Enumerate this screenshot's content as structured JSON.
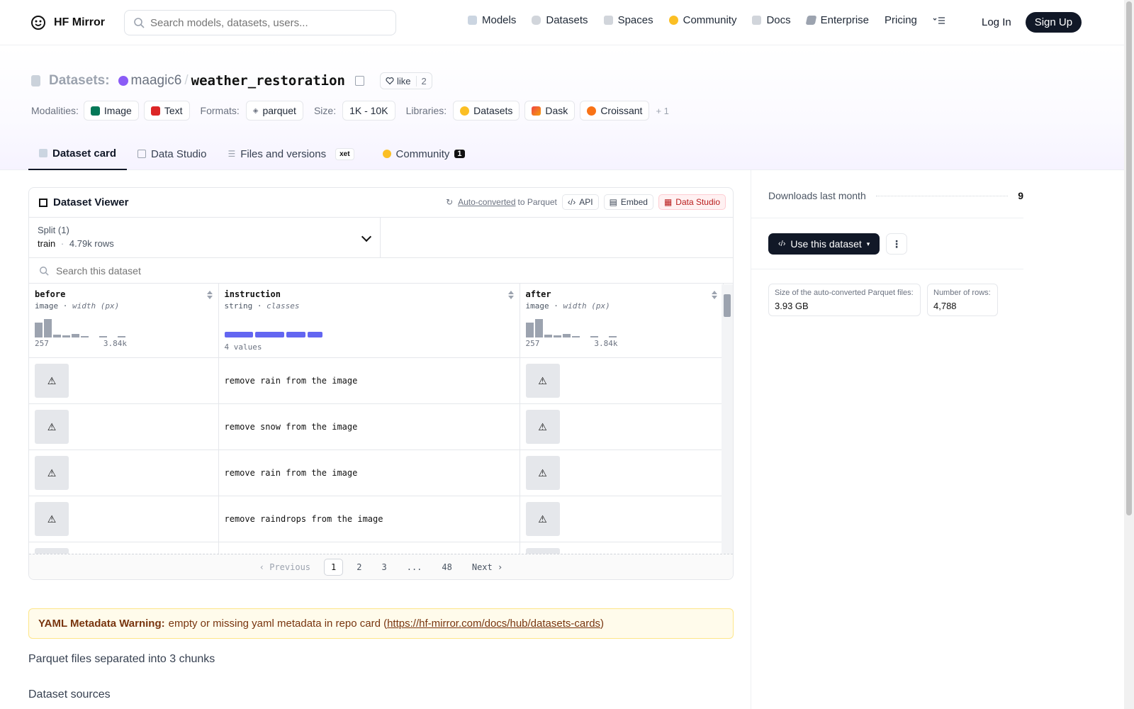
{
  "nav": {
    "brand": "HF Mirror",
    "search_placeholder": "Search models, datasets, users...",
    "links": [
      "Models",
      "Datasets",
      "Spaces",
      "Community",
      "Docs",
      "Enterprise",
      "Pricing"
    ],
    "login": "Log In",
    "signup": "Sign Up"
  },
  "header": {
    "section": "Datasets:",
    "owner": "maagic6",
    "slash": "/",
    "repo": "weather_restoration",
    "like_label": "like",
    "like_count": "2",
    "modalities_label": "Modalities:",
    "modalities": [
      "Image",
      "Text"
    ],
    "formats_label": "Formats:",
    "format": "parquet",
    "size_label": "Size:",
    "size": "1K - 10K",
    "libraries_label": "Libraries:",
    "libraries": [
      "Datasets",
      "Dask",
      "Croissant"
    ],
    "more_libraries": "+ 1"
  },
  "tabs": {
    "dataset_card": "Dataset card",
    "data_studio": "Data Studio",
    "files": "Files and versions",
    "xet": "xet",
    "community": "Community",
    "community_count": "1"
  },
  "viewer": {
    "title": "Dataset Viewer",
    "auto_converted": "Auto-converted",
    "to_parquet": "to Parquet",
    "api": "API",
    "embed": "Embed",
    "data_studio": "Data Studio",
    "split_label": "Split (1)",
    "split_value": "train",
    "split_dot": "·",
    "split_rows": "4.79k rows",
    "search_placeholder": "Search this dataset",
    "columns": [
      {
        "name": "before",
        "type": "image",
        "sub": "width (px)",
        "min": "257",
        "max": "3.84k"
      },
      {
        "name": "instruction",
        "type": "string",
        "sub": "classes",
        "values": "4 values"
      },
      {
        "name": "after",
        "type": "image",
        "sub": "width (px)",
        "min": "257",
        "max": "3.84k"
      }
    ],
    "type_sep": " · ",
    "broken_image_glyph": "⚠",
    "rows": [
      "remove rain from the image",
      "remove snow from the image",
      "remove rain from the image",
      "remove raindrops from the image",
      ""
    ],
    "pager": {
      "prev": "‹  Previous",
      "pages": [
        "1",
        "2",
        "3",
        "...",
        "48"
      ],
      "next": "Next  ›"
    }
  },
  "histogram": [
    0.8,
    1.0,
    0.15,
    0.1,
    0.2,
    0.06,
    0,
    0.04,
    0,
    0.04
  ],
  "class_widths": [
    0.3,
    0.3,
    0.2,
    0.15
  ],
  "card": {
    "warning_bold": "YAML Metadata Warning:",
    "warning_text": "empty or missing yaml metadata in repo card (",
    "warning_link": "https://hf-mirror.com/docs/hub/datasets-cards",
    "warning_close": ")",
    "p1": "Parquet files separated into 3 chunks",
    "p2": "Dataset sources"
  },
  "sidebar": {
    "downloads_label": "Downloads last month",
    "downloads": "9",
    "use_dataset": "Use this dataset",
    "more": "⋮",
    "parquet_size_label": "Size of the auto-converted Parquet files:",
    "parquet_size": "3.93 GB",
    "rows_label": "Number of rows:",
    "rows": "4,788"
  },
  "colors": {
    "accent": "#111827",
    "class_bar": "#6366f1",
    "owner_avatar": "#8b5cf6",
    "warning_bg": "#fffbeb"
  }
}
